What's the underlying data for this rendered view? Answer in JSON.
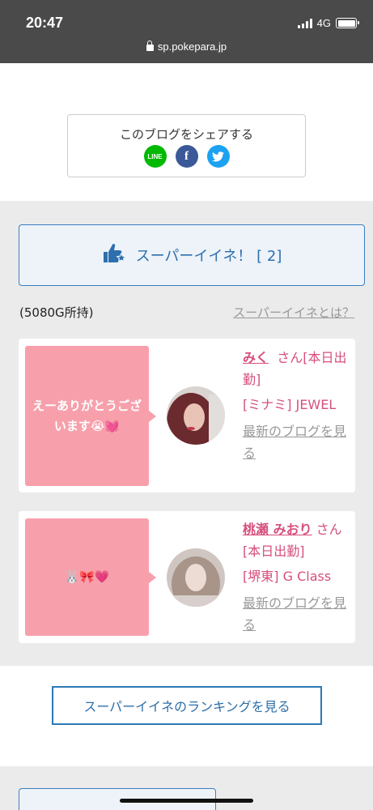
{
  "status_bar": {
    "time": "20:47",
    "network": "4G",
    "url": "sp.pokepara.jp"
  },
  "share": {
    "title": "このブログをシェアする",
    "line_label": "LINE",
    "facebook_label": "f"
  },
  "super_iine": {
    "label": "スーパーイイネ！ [ 2]"
  },
  "gold_text": "(5080G所持)",
  "about_link": "スーパーイイネとは？",
  "entries": [
    {
      "message": "えーありがとうございます😭💓",
      "name": "みく",
      "honorific": "さん",
      "status": "[本日出勤]",
      "area": "[ミナミ]",
      "shop": "JEWEL",
      "latest_link": "最新のブログを見る"
    },
    {
      "message": "🐰🎀💗",
      "name": "桃瀬 みおり",
      "honorific": "さん",
      "status": "[本日出勤]",
      "area": "[堺東]",
      "shop": "G Class",
      "latest_link": "最新のブログを見る"
    }
  ],
  "ranking_button": "スーパーイイネのランキングを見る",
  "colors": {
    "accent_blue": "#2e6fa8",
    "pink_name": "#d64f7e",
    "bubble_pink": "#f7a0ac"
  }
}
